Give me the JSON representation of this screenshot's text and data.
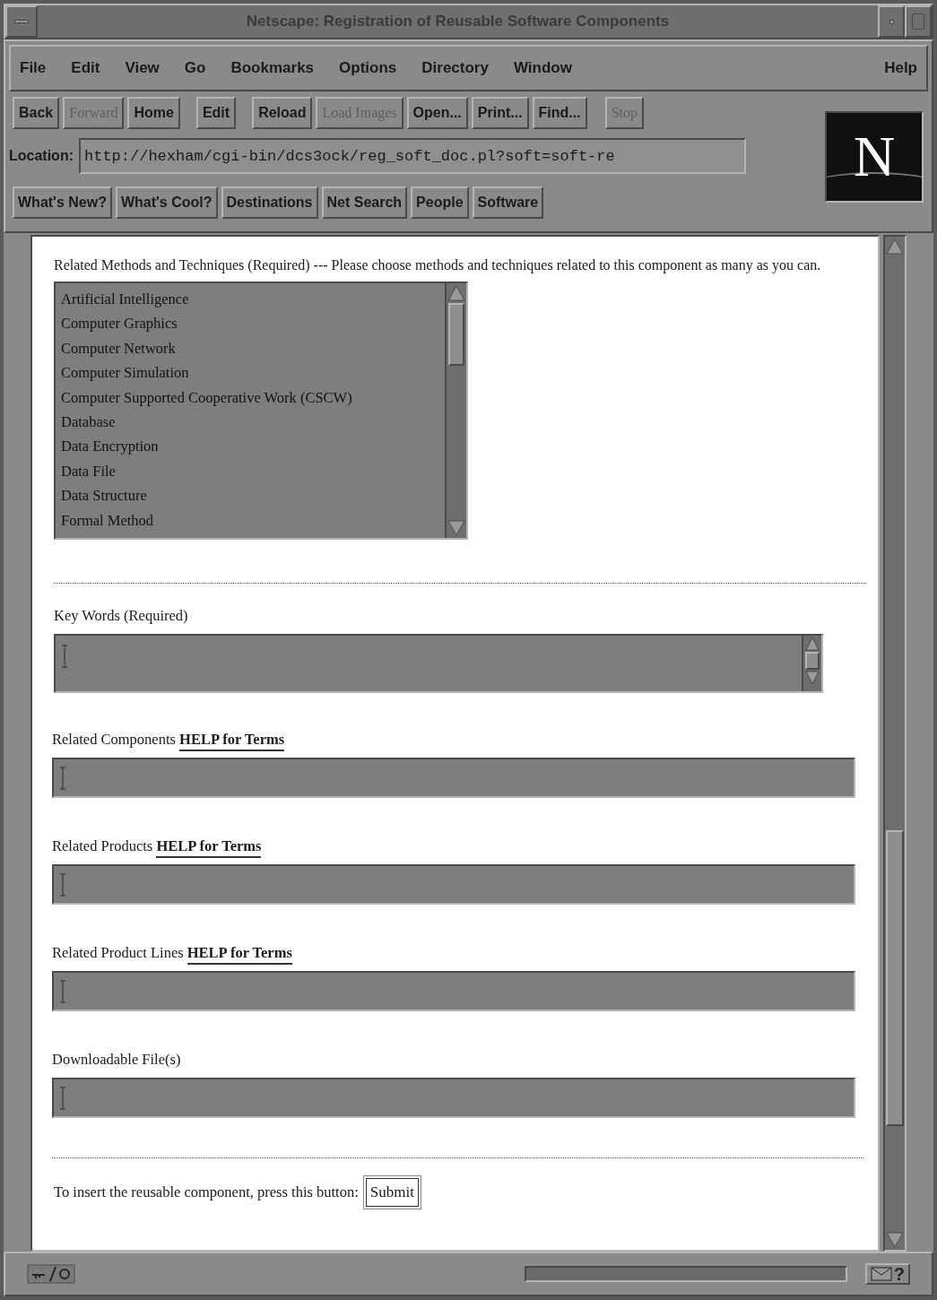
{
  "window": {
    "title": "Netscape: Registration of Reusable Software Components"
  },
  "menu": [
    {
      "label": "File"
    },
    {
      "label": "Edit"
    },
    {
      "label": "View"
    },
    {
      "label": "Go"
    },
    {
      "label": "Bookmarks"
    },
    {
      "label": "Options"
    },
    {
      "label": "Directory"
    },
    {
      "label": "Window"
    },
    {
      "label": "Help"
    }
  ],
  "toolbar": [
    {
      "label": "Back",
      "disabled": false
    },
    {
      "label": "Forward",
      "disabled": true
    },
    {
      "label": "Home",
      "disabled": false
    },
    {
      "label": "Edit",
      "disabled": false
    },
    {
      "label": "Reload",
      "disabled": false
    },
    {
      "label": "Load Images",
      "disabled": true
    },
    {
      "label": "Open...",
      "disabled": false
    },
    {
      "label": "Print...",
      "disabled": false
    },
    {
      "label": "Find...",
      "disabled": false
    },
    {
      "label": "Stop",
      "disabled": true
    }
  ],
  "location": {
    "label": "Location:",
    "value": "http://hexham/cgi-bin/dcs3ock/reg_soft_doc.pl?soft=soft-re"
  },
  "directory_buttons": [
    "What's New?",
    "What's Cool?",
    "Destinations",
    "Net Search",
    "People",
    "Software"
  ],
  "logo": {
    "letter": "N"
  },
  "form": {
    "methods": {
      "label": "Related Methods and Techniques (Required) --- Please choose methods and techniques related to this component as many as you can.",
      "options": [
        "Artificial Intelligence",
        "Computer Graphics",
        "Computer Network",
        "Computer Simulation",
        "Computer Supported Cooperative Work (CSCW)",
        "Database",
        "Data Encryption",
        "Data File",
        "Data Structure",
        "Formal Method"
      ]
    },
    "keywords": {
      "label": "Key Words (Required)"
    },
    "fields": [
      {
        "label": "Related Components",
        "link": "HELP for Terms"
      },
      {
        "label": "Related Products",
        "link": "HELP for Terms"
      },
      {
        "label": "Related Product Lines",
        "link": "HELP for Terms"
      },
      {
        "label": "Downloadable File(s)"
      }
    ],
    "submit": {
      "prompt": "To insert the reusable component, press this button:",
      "button": "Submit"
    }
  },
  "status_bar": {
    "help_glyph": "?"
  }
}
